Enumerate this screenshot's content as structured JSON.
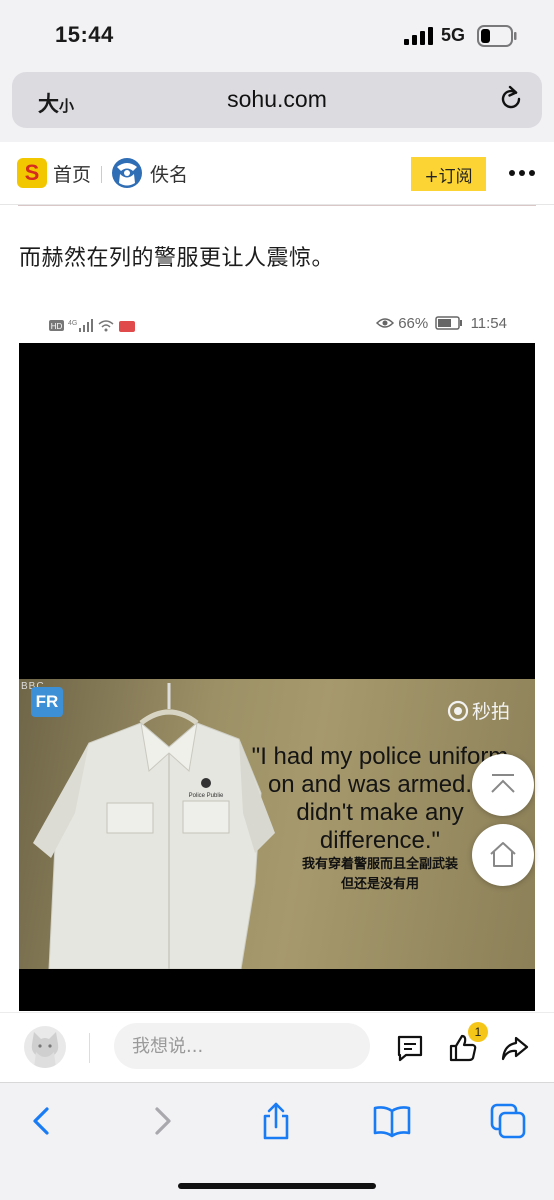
{
  "status_bar": {
    "time": "15:44",
    "network": "5G"
  },
  "address_bar": {
    "text_size_large": "大",
    "text_size_small": "小",
    "url": "sohu.com"
  },
  "sohu_header": {
    "logo_letter": "S",
    "home_label": "首页",
    "author_name": "佚名",
    "subscribe_label": "+订阅"
  },
  "article": {
    "paragraph": "而赫然在列的警服更让人震惊。",
    "embedded_screenshot": {
      "status_hd": "HD",
      "status_4g": "4G",
      "battery": "66%",
      "time": "11:54"
    },
    "video": {
      "bbc_tag": "BBC",
      "channel_logo": "FR",
      "watermark": "秒拍",
      "quote": "\"I had my police uniform on and was armed. It didn't make any difference.\"",
      "subtitle_line1": "我有穿着警服而且全副武装",
      "subtitle_line2": "但还是没有用",
      "shirt_badge": "Police Publie"
    }
  },
  "comment_bar": {
    "placeholder": "我想说...",
    "like_count": "1"
  },
  "colors": {
    "accent_yellow": "#fcd535",
    "ios_blue": "#1a7cf5",
    "toolbar_bg": "#f2f1f4"
  }
}
